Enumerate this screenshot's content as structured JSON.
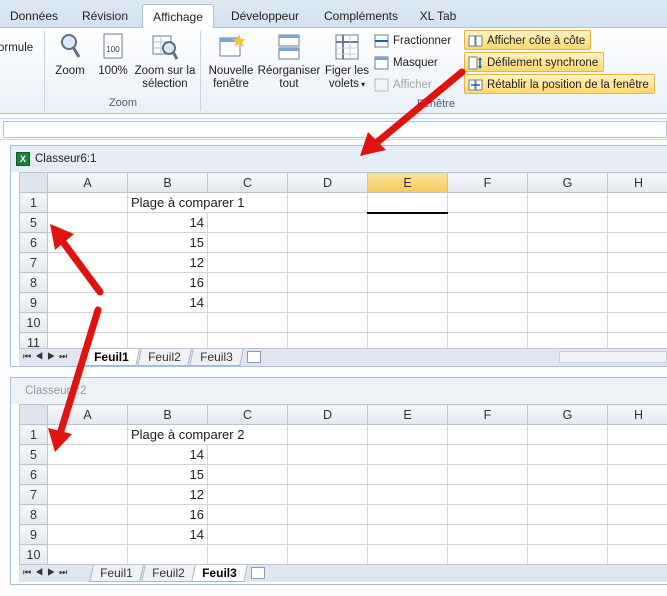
{
  "tabs": [
    "Données",
    "Révision",
    "Affichage",
    "Développeur",
    "Compléments",
    "XL Tab"
  ],
  "active_tab": "Affichage",
  "ribbon": {
    "partial_label": "ormule",
    "zoom_group": {
      "label": "Zoom",
      "buttons": [
        "Zoom",
        "100%",
        "Zoom sur la sélection"
      ]
    },
    "window_group": {
      "label": "Fenêtre",
      "nouvelle_fenetre": "Nouvelle fenêtre",
      "reorganiser": "Réorganiser tout",
      "figer": "Figer les volets",
      "fractionner": "Fractionner",
      "masquer": "Masquer",
      "afficher": "Afficher",
      "cote_a_cote": "Afficher côte à côte",
      "defilement": "Défilement synchrone",
      "retablir": "Rétablir la position de la fenêtre"
    }
  },
  "window1": {
    "title": "Classeur6:1",
    "columns": [
      "A",
      "B",
      "C",
      "D",
      "E",
      "F",
      "G",
      "H"
    ],
    "selected_column": "E",
    "rows": [
      {
        "row": "1",
        "b": "Plage à comparer 1"
      },
      {
        "row": "5",
        "b": "14"
      },
      {
        "row": "6",
        "b": "15"
      },
      {
        "row": "7",
        "b": "12"
      },
      {
        "row": "8",
        "b": "16"
      },
      {
        "row": "9",
        "b": "14"
      },
      {
        "row": "10",
        "b": ""
      },
      {
        "row": "11",
        "b": ""
      }
    ],
    "sheets": [
      "Feuil1",
      "Feuil2",
      "Feuil3"
    ],
    "active_sheet": "Feuil1"
  },
  "window2": {
    "title": "Classeur6:2",
    "columns": [
      "A",
      "B",
      "C",
      "D",
      "E",
      "F",
      "G",
      "H"
    ],
    "rows": [
      {
        "row": "1",
        "b": "Plage à comparer 2"
      },
      {
        "row": "5",
        "b": "14"
      },
      {
        "row": "6",
        "b": "15"
      },
      {
        "row": "7",
        "b": "12"
      },
      {
        "row": "8",
        "b": "16"
      },
      {
        "row": "9",
        "b": "14"
      },
      {
        "row": "10",
        "b": ""
      }
    ],
    "sheets": [
      "Feuil1",
      "Feuil2",
      "Feuil3"
    ],
    "active_sheet": "Feuil3"
  },
  "colors": {
    "arrow": "#e0130e",
    "highlight": "#ffd86a",
    "selected_header": "#f7c95a",
    "excel_green": "#1f7d3a"
  }
}
